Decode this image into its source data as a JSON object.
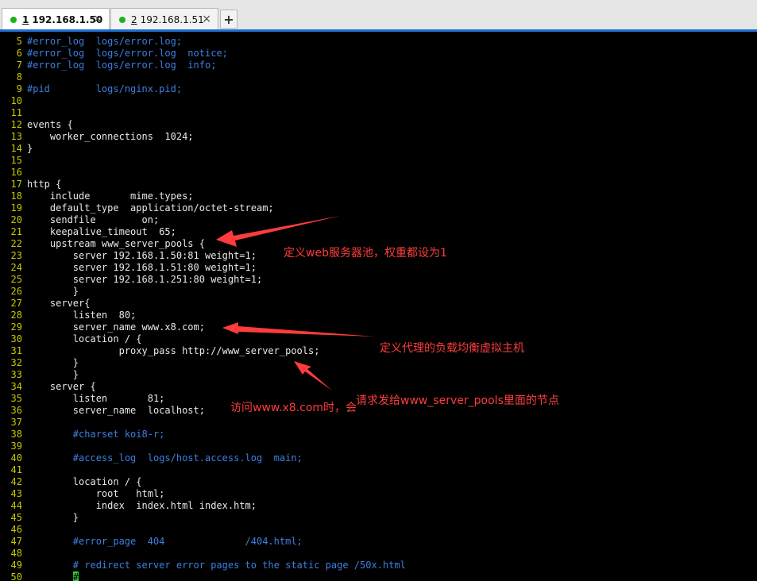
{
  "tabs": [
    {
      "num": "1",
      "label": "192.168.1.50",
      "active": true
    },
    {
      "num": "2",
      "label": "192.168.1.51",
      "active": false
    }
  ],
  "tab_add_label": "+",
  "tab_close_label": "×",
  "first_line_number": 5,
  "lines": [
    {
      "text": "#error_log  logs/error.log;",
      "comment": true
    },
    {
      "text": "#error_log  logs/error.log  notice;",
      "comment": true
    },
    {
      "text": "#error_log  logs/error.log  info;",
      "comment": true
    },
    {
      "text": "",
      "comment": false
    },
    {
      "text": "#pid        logs/nginx.pid;",
      "comment": true
    },
    {
      "text": "",
      "comment": false
    },
    {
      "text": "",
      "comment": false
    },
    {
      "text": "events {",
      "comment": false
    },
    {
      "text": "    worker_connections  1024;",
      "comment": false
    },
    {
      "text": "}",
      "comment": false
    },
    {
      "text": "",
      "comment": false
    },
    {
      "text": "",
      "comment": false
    },
    {
      "text": "http {",
      "comment": false
    },
    {
      "text": "    include       mime.types;",
      "comment": false
    },
    {
      "text": "    default_type  application/octet-stream;",
      "comment": false
    },
    {
      "text": "    sendfile        on;",
      "comment": false
    },
    {
      "text": "    keepalive_timeout  65;",
      "comment": false
    },
    {
      "text": "    upstream www_server_pools {",
      "comment": false
    },
    {
      "text": "        server 192.168.1.50:81 weight=1;",
      "comment": false
    },
    {
      "text": "        server 192.168.1.51:80 weight=1;",
      "comment": false
    },
    {
      "text": "        server 192.168.1.251:80 weight=1;",
      "comment": false
    },
    {
      "text": "        }",
      "comment": false
    },
    {
      "text": "    server{",
      "comment": false
    },
    {
      "text": "        listen  80;",
      "comment": false
    },
    {
      "text": "        server_name www.x8.com;",
      "comment": false
    },
    {
      "text": "        location / {",
      "comment": false
    },
    {
      "text": "                proxy_pass http://www_server_pools;",
      "comment": false
    },
    {
      "text": "        }",
      "comment": false
    },
    {
      "text": "        }",
      "comment": false
    },
    {
      "text": "    server {",
      "comment": false
    },
    {
      "text": "        listen       81;",
      "comment": false
    },
    {
      "text": "        server_name  localhost;",
      "comment": false
    },
    {
      "text": "",
      "comment": false
    },
    {
      "text": "        #charset koi8-r;",
      "comment": true
    },
    {
      "text": "",
      "comment": false
    },
    {
      "text": "        #access_log  logs/host.access.log  main;",
      "comment": true
    },
    {
      "text": "",
      "comment": false
    },
    {
      "text": "        location / {",
      "comment": false
    },
    {
      "text": "            root   html;",
      "comment": false
    },
    {
      "text": "            index  index.html index.htm;",
      "comment": false
    },
    {
      "text": "        }",
      "comment": false
    },
    {
      "text": "",
      "comment": false
    },
    {
      "text": "        #error_page  404              /404.html;",
      "comment": true
    },
    {
      "text": "",
      "comment": false
    },
    {
      "text": "        # redirect server error pages to the static page /50x.html",
      "comment": true
    },
    {
      "text": "        ",
      "comment": false,
      "cursor": "#"
    }
  ],
  "annotations": {
    "upstream_note": "定义web服务器池，权重都设为1",
    "server_note": "定义代理的负载均衡虚拟主机",
    "proxy_note_a": "访问www.x8.com时，会",
    "proxy_note_b": "请求发给www_server_pools里面的节点"
  },
  "colors": {
    "line_numbers": "#c8c800",
    "comments": "#3d7fe0",
    "code": "#e8e8e8",
    "annotations": "#ff3c3c",
    "status_dot": "#19b319"
  }
}
